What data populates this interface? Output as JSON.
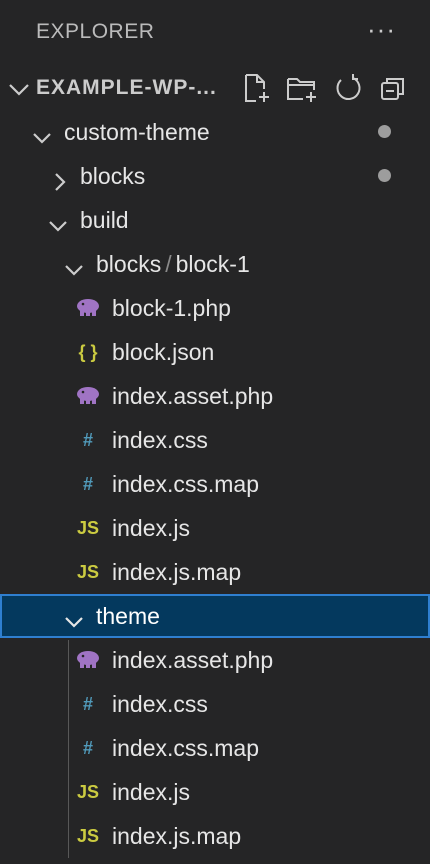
{
  "explorer": {
    "title": "EXPLORER",
    "more": "···"
  },
  "section": {
    "name": "EXAMPLE-WP-...",
    "actions": [
      "new-file-icon",
      "new-folder-icon",
      "refresh-icon",
      "collapse-all-icon"
    ]
  },
  "tree": [
    {
      "label": "custom-theme",
      "type": "folder",
      "expanded": true,
      "modified": true
    },
    {
      "label": "blocks",
      "type": "folder",
      "expanded": false,
      "modified": true
    },
    {
      "label": "build",
      "type": "folder",
      "expanded": true
    },
    {
      "label_a": "blocks",
      "label_sep": "/",
      "label_b": "block-1",
      "type": "folder",
      "expanded": true
    },
    {
      "label": "block-1.php",
      "type": "php"
    },
    {
      "label": "block.json",
      "type": "json"
    },
    {
      "label": "index.asset.php",
      "type": "php"
    },
    {
      "label": "index.css",
      "type": "css"
    },
    {
      "label": "index.css.map",
      "type": "css"
    },
    {
      "label": "index.js",
      "type": "js"
    },
    {
      "label": "index.js.map",
      "type": "js"
    },
    {
      "label": "theme",
      "type": "folder",
      "expanded": true,
      "selected": true
    },
    {
      "label": "index.asset.php",
      "type": "php"
    },
    {
      "label": "index.css",
      "type": "css"
    },
    {
      "label": "index.css.map",
      "type": "css"
    },
    {
      "label": "index.js",
      "type": "js"
    },
    {
      "label": "index.js.map",
      "type": "js"
    }
  ],
  "icon_glyphs": {
    "js": "JS",
    "css": "#",
    "json": "{ }"
  },
  "colors": {
    "background": "#252526",
    "selected_bg": "#04395e",
    "selected_border": "#2f7fd0",
    "php_icon": "#a074c4",
    "js_icon": "#cbcb41",
    "css_icon": "#519aba",
    "json_icon": "#cbcb41",
    "modified_dot": "#9d9d9d"
  }
}
